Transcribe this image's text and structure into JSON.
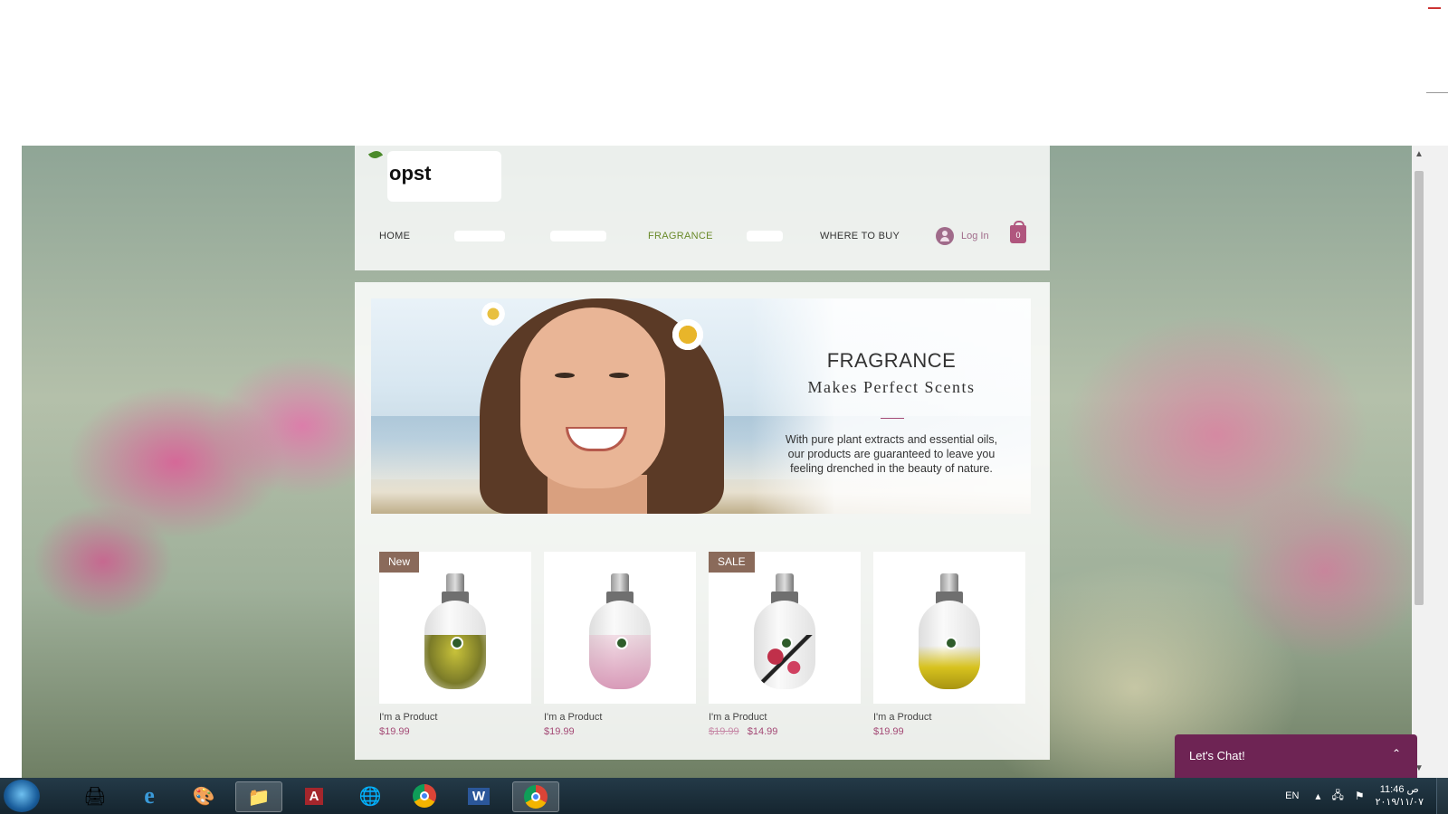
{
  "site": {
    "logo_text": "opst",
    "nav": {
      "home": "HOME",
      "fragrance": "FRAGRANCE",
      "where_to_buy": "WHERE TO BUY",
      "login": "Log In",
      "cart_count": "0"
    },
    "banner": {
      "title": "FRAGRANCE",
      "subtitle": "Makes Perfect Scents",
      "text": "With pure plant extracts and essential oils, our products are guaranteed to leave you feeling drenched in the beauty of nature."
    },
    "products": [
      {
        "badge": "New",
        "name": "I'm a Product",
        "price": "$19.99",
        "old_price": ""
      },
      {
        "badge": "",
        "name": "I'm a Product",
        "price": "$19.99",
        "old_price": ""
      },
      {
        "badge": "SALE",
        "name": "I'm a Product",
        "price": "$14.99",
        "old_price": "$19.99"
      },
      {
        "badge": "",
        "name": "I'm a Product",
        "price": "$19.99",
        "old_price": ""
      }
    ],
    "chat": {
      "label": "Let's Chat!"
    }
  },
  "taskbar": {
    "apps": [
      "scanner-icon",
      "internet-explorer-icon",
      "paint-icon",
      "file-explorer-icon",
      "access-icon",
      "globe-icon",
      "chrome-icon",
      "word-icon",
      "chrome-active-icon"
    ],
    "language": "EN",
    "time": "11:46 ص",
    "date": "٢٠١٩/١١/٠٧"
  },
  "colors": {
    "accent": "#a44a76",
    "nav_active": "#6a8a2a",
    "chat_bg": "#6e2454",
    "badge_bg": "#8a6a5a"
  }
}
